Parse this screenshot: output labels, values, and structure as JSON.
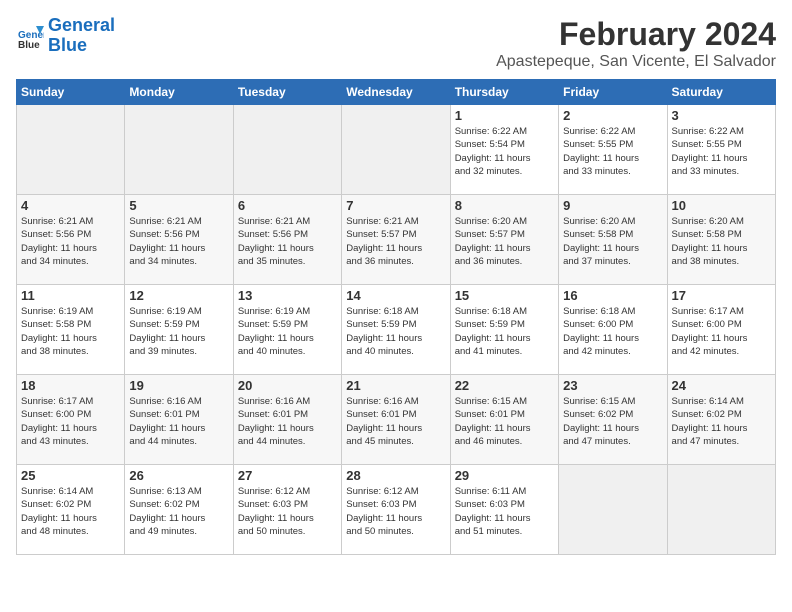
{
  "header": {
    "logo_line1": "General",
    "logo_line2": "Blue",
    "month": "February 2024",
    "location": "Apastepeque, San Vicente, El Salvador"
  },
  "days_of_week": [
    "Sunday",
    "Monday",
    "Tuesday",
    "Wednesday",
    "Thursday",
    "Friday",
    "Saturday"
  ],
  "weeks": [
    [
      {
        "day": "",
        "info": ""
      },
      {
        "day": "",
        "info": ""
      },
      {
        "day": "",
        "info": ""
      },
      {
        "day": "",
        "info": ""
      },
      {
        "day": "1",
        "info": "Sunrise: 6:22 AM\nSunset: 5:54 PM\nDaylight: 11 hours\nand 32 minutes."
      },
      {
        "day": "2",
        "info": "Sunrise: 6:22 AM\nSunset: 5:55 PM\nDaylight: 11 hours\nand 33 minutes."
      },
      {
        "day": "3",
        "info": "Sunrise: 6:22 AM\nSunset: 5:55 PM\nDaylight: 11 hours\nand 33 minutes."
      }
    ],
    [
      {
        "day": "4",
        "info": "Sunrise: 6:21 AM\nSunset: 5:56 PM\nDaylight: 11 hours\nand 34 minutes."
      },
      {
        "day": "5",
        "info": "Sunrise: 6:21 AM\nSunset: 5:56 PM\nDaylight: 11 hours\nand 34 minutes."
      },
      {
        "day": "6",
        "info": "Sunrise: 6:21 AM\nSunset: 5:56 PM\nDaylight: 11 hours\nand 35 minutes."
      },
      {
        "day": "7",
        "info": "Sunrise: 6:21 AM\nSunset: 5:57 PM\nDaylight: 11 hours\nand 36 minutes."
      },
      {
        "day": "8",
        "info": "Sunrise: 6:20 AM\nSunset: 5:57 PM\nDaylight: 11 hours\nand 36 minutes."
      },
      {
        "day": "9",
        "info": "Sunrise: 6:20 AM\nSunset: 5:58 PM\nDaylight: 11 hours\nand 37 minutes."
      },
      {
        "day": "10",
        "info": "Sunrise: 6:20 AM\nSunset: 5:58 PM\nDaylight: 11 hours\nand 38 minutes."
      }
    ],
    [
      {
        "day": "11",
        "info": "Sunrise: 6:19 AM\nSunset: 5:58 PM\nDaylight: 11 hours\nand 38 minutes."
      },
      {
        "day": "12",
        "info": "Sunrise: 6:19 AM\nSunset: 5:59 PM\nDaylight: 11 hours\nand 39 minutes."
      },
      {
        "day": "13",
        "info": "Sunrise: 6:19 AM\nSunset: 5:59 PM\nDaylight: 11 hours\nand 40 minutes."
      },
      {
        "day": "14",
        "info": "Sunrise: 6:18 AM\nSunset: 5:59 PM\nDaylight: 11 hours\nand 40 minutes."
      },
      {
        "day": "15",
        "info": "Sunrise: 6:18 AM\nSunset: 5:59 PM\nDaylight: 11 hours\nand 41 minutes."
      },
      {
        "day": "16",
        "info": "Sunrise: 6:18 AM\nSunset: 6:00 PM\nDaylight: 11 hours\nand 42 minutes."
      },
      {
        "day": "17",
        "info": "Sunrise: 6:17 AM\nSunset: 6:00 PM\nDaylight: 11 hours\nand 42 minutes."
      }
    ],
    [
      {
        "day": "18",
        "info": "Sunrise: 6:17 AM\nSunset: 6:00 PM\nDaylight: 11 hours\nand 43 minutes."
      },
      {
        "day": "19",
        "info": "Sunrise: 6:16 AM\nSunset: 6:01 PM\nDaylight: 11 hours\nand 44 minutes."
      },
      {
        "day": "20",
        "info": "Sunrise: 6:16 AM\nSunset: 6:01 PM\nDaylight: 11 hours\nand 44 minutes."
      },
      {
        "day": "21",
        "info": "Sunrise: 6:16 AM\nSunset: 6:01 PM\nDaylight: 11 hours\nand 45 minutes."
      },
      {
        "day": "22",
        "info": "Sunrise: 6:15 AM\nSunset: 6:01 PM\nDaylight: 11 hours\nand 46 minutes."
      },
      {
        "day": "23",
        "info": "Sunrise: 6:15 AM\nSunset: 6:02 PM\nDaylight: 11 hours\nand 47 minutes."
      },
      {
        "day": "24",
        "info": "Sunrise: 6:14 AM\nSunset: 6:02 PM\nDaylight: 11 hours\nand 47 minutes."
      }
    ],
    [
      {
        "day": "25",
        "info": "Sunrise: 6:14 AM\nSunset: 6:02 PM\nDaylight: 11 hours\nand 48 minutes."
      },
      {
        "day": "26",
        "info": "Sunrise: 6:13 AM\nSunset: 6:02 PM\nDaylight: 11 hours\nand 49 minutes."
      },
      {
        "day": "27",
        "info": "Sunrise: 6:12 AM\nSunset: 6:03 PM\nDaylight: 11 hours\nand 50 minutes."
      },
      {
        "day": "28",
        "info": "Sunrise: 6:12 AM\nSunset: 6:03 PM\nDaylight: 11 hours\nand 50 minutes."
      },
      {
        "day": "29",
        "info": "Sunrise: 6:11 AM\nSunset: 6:03 PM\nDaylight: 11 hours\nand 51 minutes."
      },
      {
        "day": "",
        "info": ""
      },
      {
        "day": "",
        "info": ""
      }
    ]
  ]
}
